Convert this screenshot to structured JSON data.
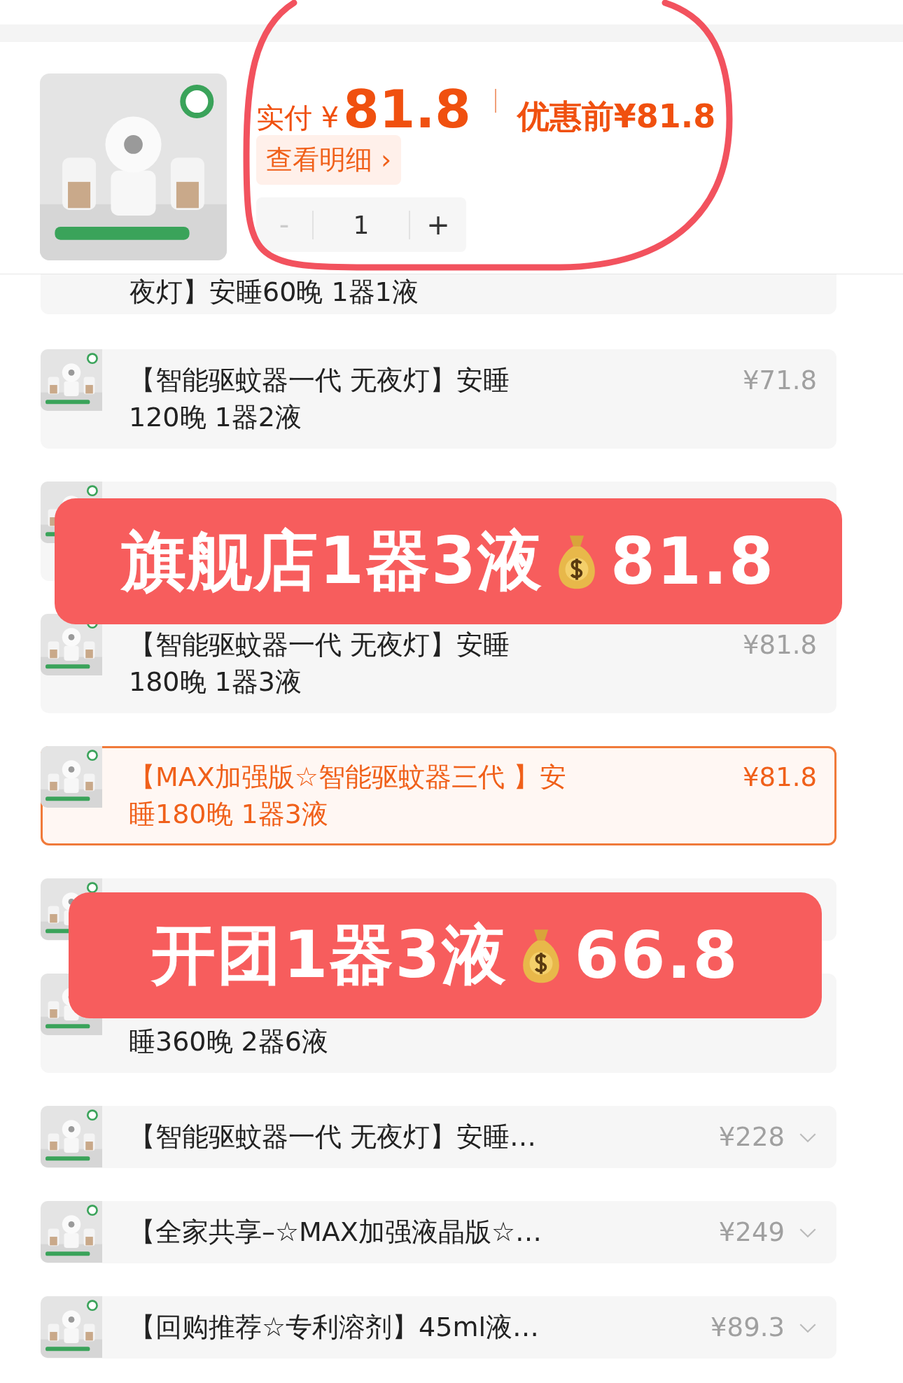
{
  "header": {
    "paid_label": "实付 ¥",
    "paid_amount": "81.8",
    "before_price": "优惠前¥81.8",
    "details_link": "查看明细 ›",
    "stepper": {
      "minus": "-",
      "quantity": "1",
      "plus": "+"
    }
  },
  "options": [
    {
      "lines": [
        "夜灯】安睡60晚 1器1液"
      ],
      "expanded": true,
      "selected": false,
      "partial": true
    },
    {
      "lines": [
        "【智能驱蚊器一代  无夜灯】安睡",
        "120晚 1器2液"
      ],
      "price": "¥71.8",
      "expanded": true,
      "selected": false,
      "partial": false
    },
    {
      "selected": false,
      "partial": false
    },
    {
      "lines": [
        "【智能驱蚊器一代 无夜灯】安睡",
        "180晚 1器3液"
      ],
      "price": "¥81.8",
      "expanded": true,
      "selected": false,
      "partial": false
    },
    {
      "lines": [
        "【MAX加强版☆智能驱蚊器三代 】安",
        "睡180晚 1器3液"
      ],
      "price": "¥81.8",
      "expanded": true,
      "selected": true,
      "partial": false
    },
    {
      "selected": false,
      "partial": false,
      "short": true
    },
    {
      "lines": [
        "睡360晚 2器6液"
      ],
      "expanded": true,
      "selected": false,
      "partial": false,
      "tail": true
    },
    {
      "lines": [
        "【智能驱蚊器一代 无夜灯】安睡…"
      ],
      "price": "¥228",
      "expanded": false,
      "selected": false,
      "partial": false
    },
    {
      "lines": [
        "【全家共享–☆MAX加强液晶版☆…"
      ],
      "price": "¥249",
      "expanded": false,
      "selected": false,
      "partial": false
    },
    {
      "lines": [
        "【回购推荐☆专利溶剂】45ml液…"
      ],
      "price": "¥89.3",
      "expanded": false,
      "selected": false,
      "partial": false
    }
  ],
  "banners": [
    {
      "text": "旗舰店1器3液",
      "amount": "81.8"
    },
    {
      "text": "开团1器3液",
      "amount": "66.8"
    }
  ]
}
